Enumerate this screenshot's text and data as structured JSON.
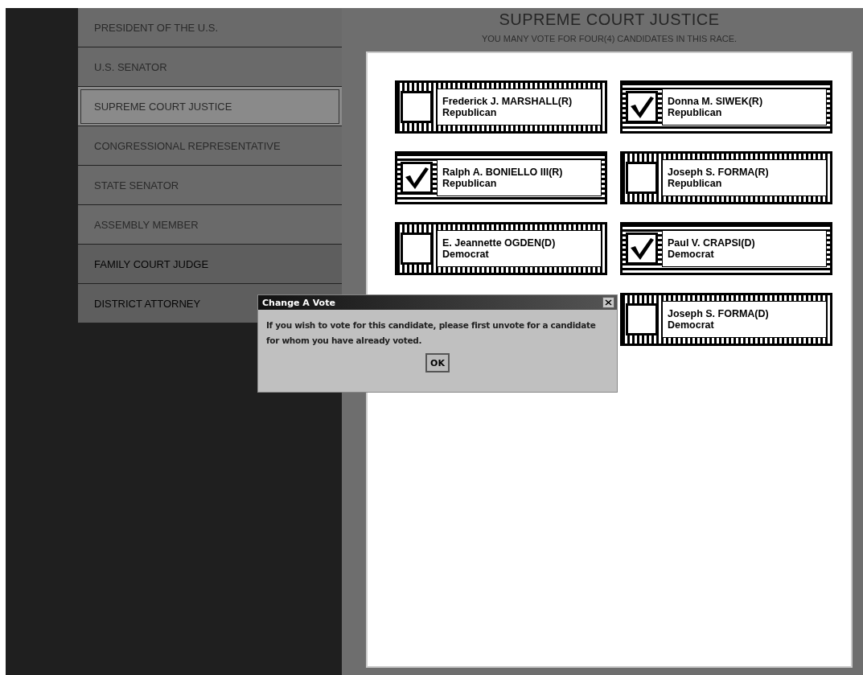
{
  "races": [
    {
      "label": "PRESIDENT OF THE U.S.",
      "selected": false,
      "disabled": false
    },
    {
      "label": "U.S. SENATOR",
      "selected": false,
      "disabled": false
    },
    {
      "label": "SUPREME COURT JUSTICE",
      "selected": true,
      "disabled": false
    },
    {
      "label": "CONGRESSIONAL REPRESENTATIVE",
      "selected": false,
      "disabled": false
    },
    {
      "label": "STATE SENATOR",
      "selected": false,
      "disabled": false
    },
    {
      "label": "ASSEMBLY MEMBER",
      "selected": false,
      "disabled": false
    },
    {
      "label": "FAMILY COURT JUDGE",
      "selected": false,
      "disabled": true
    },
    {
      "label": "DISTRICT ATTORNEY",
      "selected": false,
      "disabled": true
    }
  ],
  "ballot": {
    "title": "SUPREME COURT JUSTICE",
    "instruction": "YOU MANY VOTE FOR FOUR(4) CANDIDATES IN THIS RACE.",
    "candidates": [
      {
        "name": "Frederick J. MARSHALL(R)",
        "party": "Republican",
        "checked": false
      },
      {
        "name": "Donna M. SIWEK(R)",
        "party": "Republican",
        "checked": true
      },
      {
        "name": "Ralph A. BONIELLO III(R)",
        "party": "Republican",
        "checked": true
      },
      {
        "name": "Joseph S. FORMA(R)",
        "party": "Republican",
        "checked": false
      },
      {
        "name": "E. Jeannette OGDEN(D)",
        "party": "Democrat",
        "checked": false
      },
      {
        "name": "Paul V. CRAPSI(D)",
        "party": "Democrat",
        "checked": true
      },
      {
        "name": "Joseph S. FORMA(D)",
        "party": "Democrat",
        "checked": false
      }
    ]
  },
  "dialog": {
    "title": "Change A Vote",
    "message": "If you wish to vote for this candidate, please first unvote for a candidate for whom you have already voted.",
    "button": "OK"
  }
}
